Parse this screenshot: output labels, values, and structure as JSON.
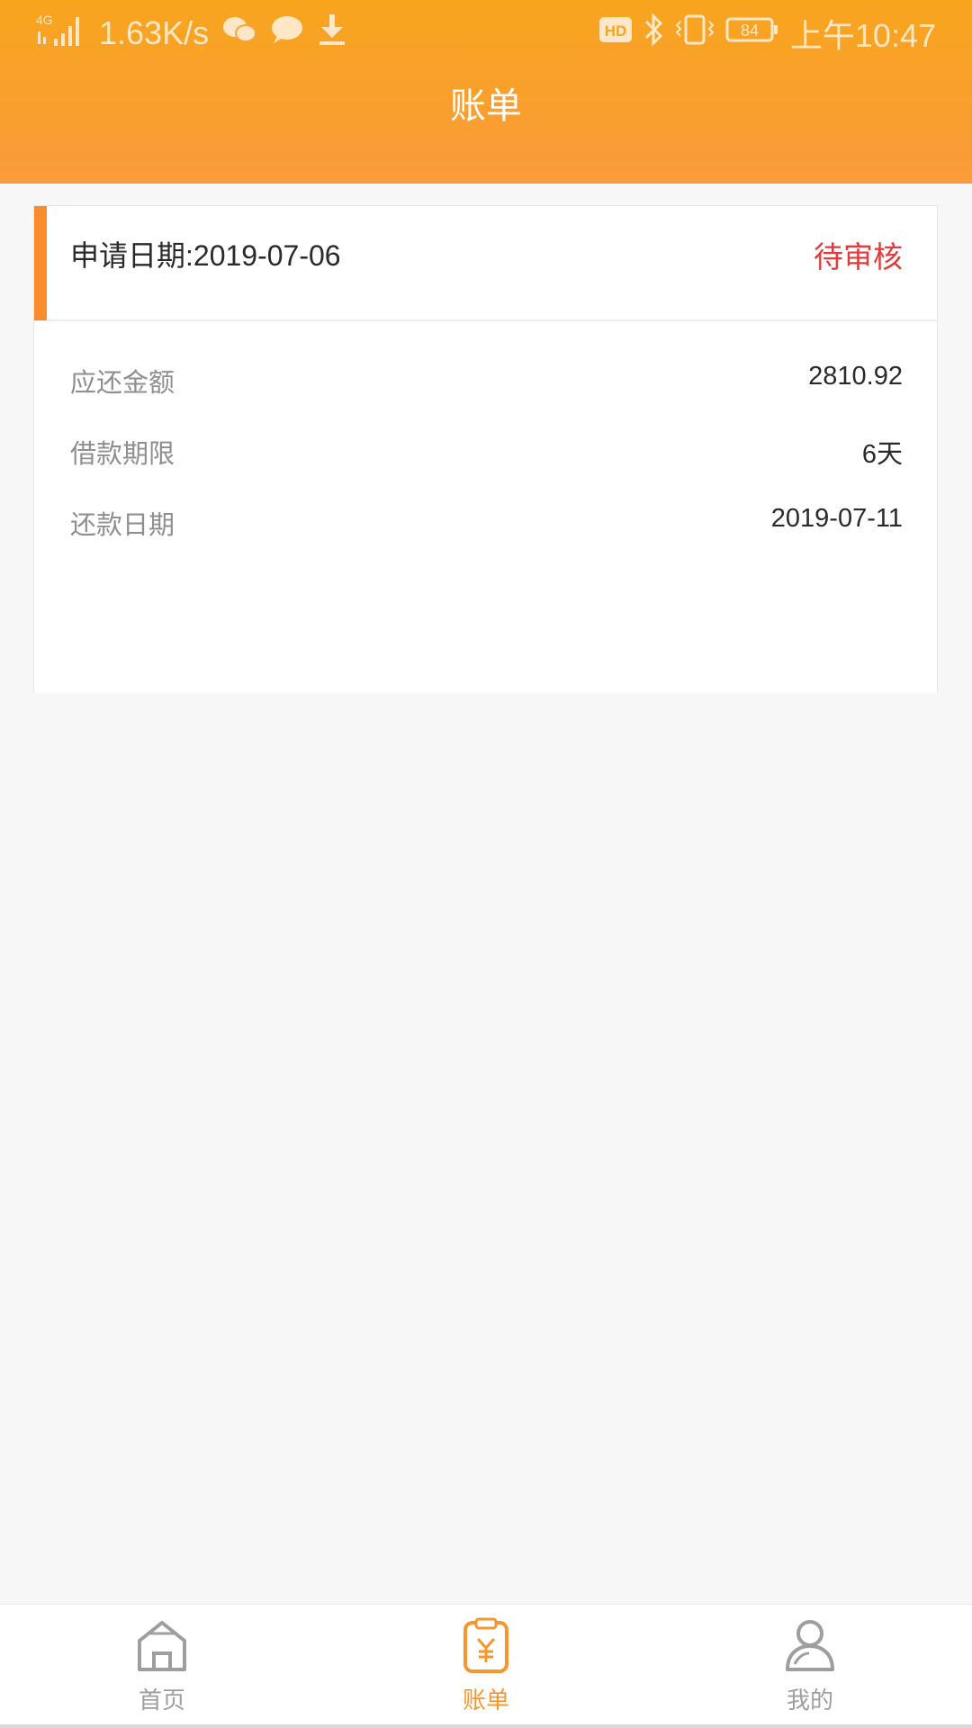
{
  "status_bar": {
    "network": "4G",
    "speed": "1.63K/s",
    "battery": "84",
    "time": "上午10:47"
  },
  "header": {
    "title": "账单"
  },
  "bill": {
    "apply_date": "申请日期:2019-07-06",
    "status": "待审核",
    "rows": [
      {
        "label": "应还金额",
        "value": "2810.92"
      },
      {
        "label": "借款期限",
        "value": "6天"
      },
      {
        "label": "还款日期",
        "value": "2019-07-11"
      }
    ]
  },
  "tabbar": {
    "tabs": [
      {
        "label": "首页",
        "icon": "home-icon",
        "active": false
      },
      {
        "label": "账单",
        "icon": "bill-icon",
        "active": true
      },
      {
        "label": "我的",
        "icon": "person-icon",
        "active": false
      }
    ]
  },
  "colors": {
    "header_start": "#f8a51e",
    "header_end": "#fa9b3a",
    "accent": "#fa8c2d",
    "status_pending": "#e13b3b",
    "tab_active": "#f7962e",
    "tab_inactive": "#9e9e9e"
  }
}
